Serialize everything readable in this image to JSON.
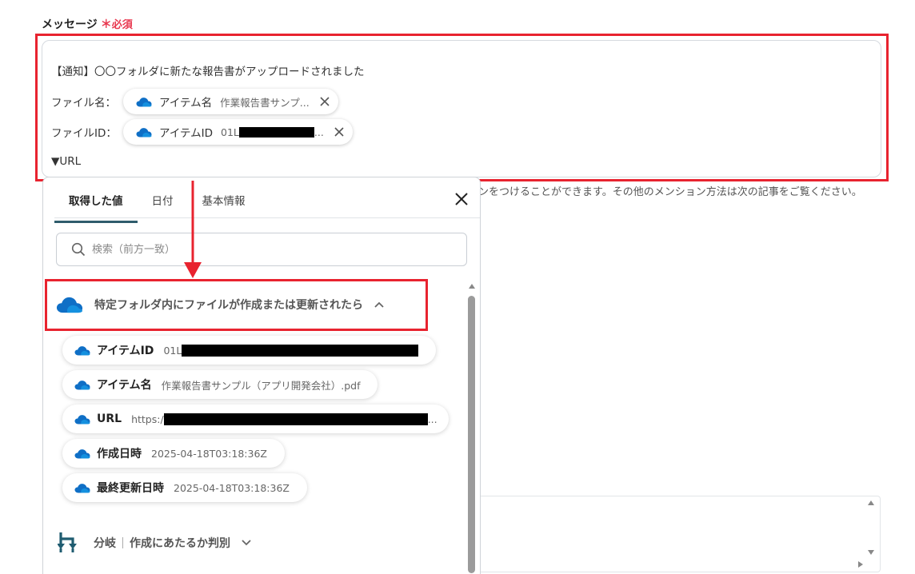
{
  "field": {
    "label": "メッセージ",
    "required_star": "＊",
    "required_text": "必須"
  },
  "message": {
    "line1": "【通知】〇〇フォルダに新たな報告書がアップロードされました",
    "file_name_label": "ファイル名：",
    "file_name_chip": {
      "name": "アイテム名",
      "value": "作業報告書サンプ..."
    },
    "file_id_label": "ファイルID：",
    "file_id_chip": {
      "name": "アイテムID",
      "value_prefix": "01L",
      "value_suffix": "..."
    },
    "url_line": "▼URL"
  },
  "help_text": "ンをつけることができます。その他のメンション方法は次の記事をご覧ください。",
  "popup": {
    "tabs": [
      "取得した値",
      "日付",
      "基本情報"
    ],
    "search_placeholder": "検索（前方一致）",
    "section_title": "特定フォルダ内にファイルが作成または更新されたら",
    "items": [
      {
        "name": "アイテムID",
        "value": "01L"
      },
      {
        "name": "アイテム名",
        "value": "作業報告書サンプル（アプリ開発会社）.pdf"
      },
      {
        "name": "URL",
        "value": "https:/",
        "value_suffix": "..."
      },
      {
        "name": "作成日時",
        "value": "2025-04-18T03:18:36Z"
      },
      {
        "name": "最終更新日時",
        "value": "2025-04-18T03:18:36Z"
      }
    ],
    "branch": {
      "label": "分岐",
      "name": "作成にあたるか判別"
    }
  },
  "colors": {
    "highlight_red": "#e8232f",
    "required_red": "#e8384f",
    "onedrive_blue": "#0f6fc6",
    "tab_underline": "#2f5c6c",
    "branch_teal": "#1f5c70"
  },
  "icons": {
    "service": "onedrive-cloud-icon",
    "branch": "branch-icon"
  }
}
